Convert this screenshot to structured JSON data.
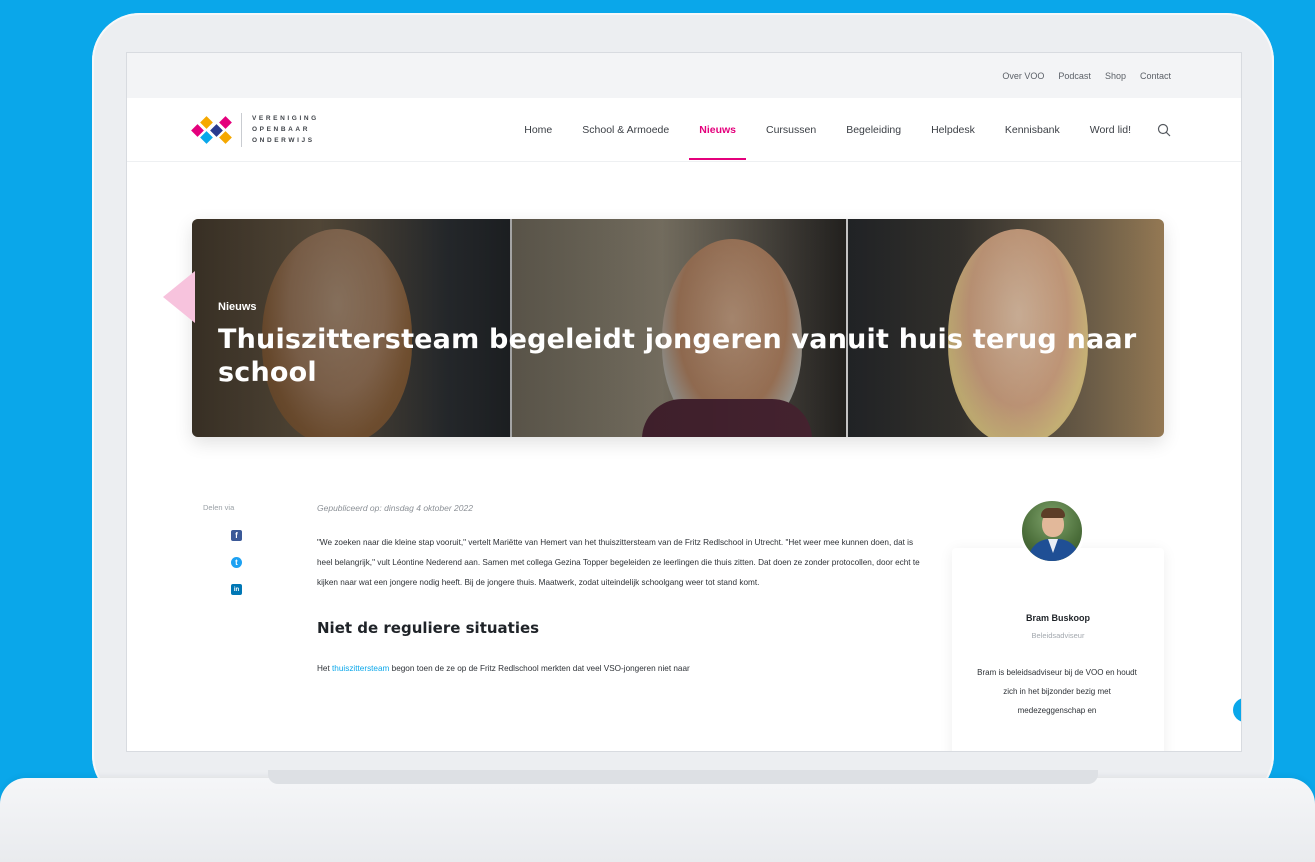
{
  "top_links": [
    "Over VOO",
    "Podcast",
    "Shop",
    "Contact"
  ],
  "logo": {
    "lines": [
      "VERENIGING",
      "OPENBAAR",
      "ONDERWIJS"
    ],
    "colors": [
      "#e4007c",
      "#f5a800",
      "#0aa7ea",
      "#2a3b8f",
      "#e4007c",
      "#f5a800"
    ]
  },
  "nav": {
    "items": [
      "Home",
      "School & Armoede",
      "Nieuws",
      "Cursussen",
      "Begeleiding",
      "Helpdesk",
      "Kennisbank",
      "Word lid!"
    ],
    "active": "Nieuws",
    "search_icon": "search-icon"
  },
  "hero": {
    "tag": "Nieuws",
    "title": "Thuiszittersteam begeleidt jongeren vanuit huis terug naar school"
  },
  "share": {
    "label": "Delen via",
    "icons": [
      {
        "name": "facebook-icon",
        "glyph": "f",
        "color": "#3b5998"
      },
      {
        "name": "twitter-icon",
        "glyph": "t",
        "color": "#1da1f2"
      },
      {
        "name": "linkedin-icon",
        "glyph": "in",
        "color": "#0077b5"
      }
    ]
  },
  "article": {
    "published": "Gepubliceerd op: dinsdag 4 oktober 2022",
    "intro": "\"We zoeken naar die kleine stap vooruit,\" vertelt Mariëtte van Hemert van het thuiszittersteam van de Fritz Redlschool in Utrecht. \"Het weer mee kunnen doen, dat is heel belangrijk,\" vult Léontine Nederend aan. Samen met collega Gezina Topper begeleiden ze leerlingen die thuis zitten. Dat doen ze zonder protocollen, door echt te kijken naar wat een jongere nodig heeft. Bij de jongere thuis. Maatwerk, zodat uiteindelijk schoolgang weer tot stand komt.",
    "subheading": "Niet de reguliere situaties",
    "p2_before": "Het ",
    "p2_link": "thuiszittersteam",
    "p2_after": " begon toen de ze op de Fritz Redlschool merkten dat veel VSO-jongeren niet naar"
  },
  "author": {
    "name": "Bram Buskoop",
    "role": "Beleidsadviseur",
    "bio": "Bram is beleidsadviseur bij de VOO en houdt zich in het bijzonder bezig met medezeggenschap en"
  },
  "colors": {
    "accent": "#e4007c",
    "brand_blue": "#0aa7ea",
    "background": "#0aa7ea"
  }
}
